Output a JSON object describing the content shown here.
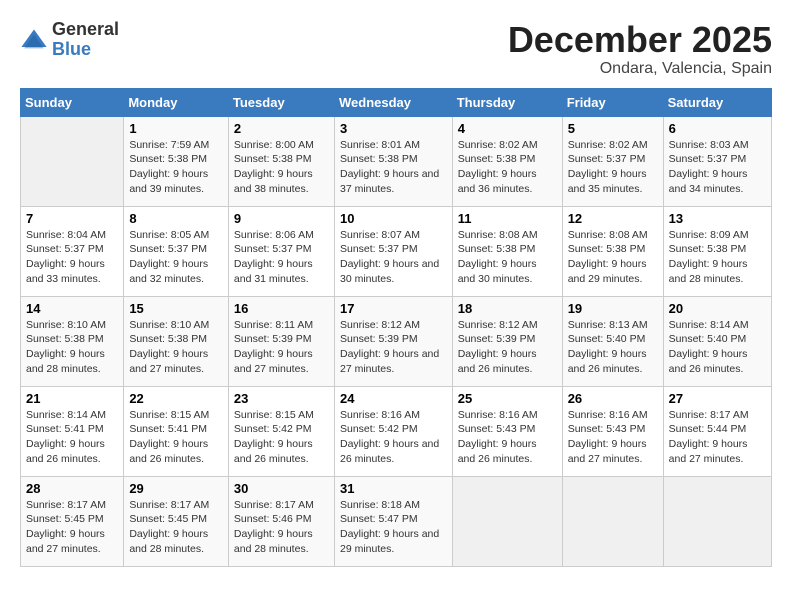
{
  "logo": {
    "general": "General",
    "blue": "Blue"
  },
  "title": "December 2025",
  "subtitle": "Ondara, Valencia, Spain",
  "days_header": [
    "Sunday",
    "Monday",
    "Tuesday",
    "Wednesday",
    "Thursday",
    "Friday",
    "Saturday"
  ],
  "weeks": [
    [
      {
        "num": "",
        "sunrise": "",
        "sunset": "",
        "daylight": ""
      },
      {
        "num": "1",
        "sunrise": "Sunrise: 7:59 AM",
        "sunset": "Sunset: 5:38 PM",
        "daylight": "Daylight: 9 hours and 39 minutes."
      },
      {
        "num": "2",
        "sunrise": "Sunrise: 8:00 AM",
        "sunset": "Sunset: 5:38 PM",
        "daylight": "Daylight: 9 hours and 38 minutes."
      },
      {
        "num": "3",
        "sunrise": "Sunrise: 8:01 AM",
        "sunset": "Sunset: 5:38 PM",
        "daylight": "Daylight: 9 hours and 37 minutes."
      },
      {
        "num": "4",
        "sunrise": "Sunrise: 8:02 AM",
        "sunset": "Sunset: 5:38 PM",
        "daylight": "Daylight: 9 hours and 36 minutes."
      },
      {
        "num": "5",
        "sunrise": "Sunrise: 8:02 AM",
        "sunset": "Sunset: 5:37 PM",
        "daylight": "Daylight: 9 hours and 35 minutes."
      },
      {
        "num": "6",
        "sunrise": "Sunrise: 8:03 AM",
        "sunset": "Sunset: 5:37 PM",
        "daylight": "Daylight: 9 hours and 34 minutes."
      }
    ],
    [
      {
        "num": "7",
        "sunrise": "Sunrise: 8:04 AM",
        "sunset": "Sunset: 5:37 PM",
        "daylight": "Daylight: 9 hours and 33 minutes."
      },
      {
        "num": "8",
        "sunrise": "Sunrise: 8:05 AM",
        "sunset": "Sunset: 5:37 PM",
        "daylight": "Daylight: 9 hours and 32 minutes."
      },
      {
        "num": "9",
        "sunrise": "Sunrise: 8:06 AM",
        "sunset": "Sunset: 5:37 PM",
        "daylight": "Daylight: 9 hours and 31 minutes."
      },
      {
        "num": "10",
        "sunrise": "Sunrise: 8:07 AM",
        "sunset": "Sunset: 5:37 PM",
        "daylight": "Daylight: 9 hours and 30 minutes."
      },
      {
        "num": "11",
        "sunrise": "Sunrise: 8:08 AM",
        "sunset": "Sunset: 5:38 PM",
        "daylight": "Daylight: 9 hours and 30 minutes."
      },
      {
        "num": "12",
        "sunrise": "Sunrise: 8:08 AM",
        "sunset": "Sunset: 5:38 PM",
        "daylight": "Daylight: 9 hours and 29 minutes."
      },
      {
        "num": "13",
        "sunrise": "Sunrise: 8:09 AM",
        "sunset": "Sunset: 5:38 PM",
        "daylight": "Daylight: 9 hours and 28 minutes."
      }
    ],
    [
      {
        "num": "14",
        "sunrise": "Sunrise: 8:10 AM",
        "sunset": "Sunset: 5:38 PM",
        "daylight": "Daylight: 9 hours and 28 minutes."
      },
      {
        "num": "15",
        "sunrise": "Sunrise: 8:10 AM",
        "sunset": "Sunset: 5:38 PM",
        "daylight": "Daylight: 9 hours and 27 minutes."
      },
      {
        "num": "16",
        "sunrise": "Sunrise: 8:11 AM",
        "sunset": "Sunset: 5:39 PM",
        "daylight": "Daylight: 9 hours and 27 minutes."
      },
      {
        "num": "17",
        "sunrise": "Sunrise: 8:12 AM",
        "sunset": "Sunset: 5:39 PM",
        "daylight": "Daylight: 9 hours and 27 minutes."
      },
      {
        "num": "18",
        "sunrise": "Sunrise: 8:12 AM",
        "sunset": "Sunset: 5:39 PM",
        "daylight": "Daylight: 9 hours and 26 minutes."
      },
      {
        "num": "19",
        "sunrise": "Sunrise: 8:13 AM",
        "sunset": "Sunset: 5:40 PM",
        "daylight": "Daylight: 9 hours and 26 minutes."
      },
      {
        "num": "20",
        "sunrise": "Sunrise: 8:14 AM",
        "sunset": "Sunset: 5:40 PM",
        "daylight": "Daylight: 9 hours and 26 minutes."
      }
    ],
    [
      {
        "num": "21",
        "sunrise": "Sunrise: 8:14 AM",
        "sunset": "Sunset: 5:41 PM",
        "daylight": "Daylight: 9 hours and 26 minutes."
      },
      {
        "num": "22",
        "sunrise": "Sunrise: 8:15 AM",
        "sunset": "Sunset: 5:41 PM",
        "daylight": "Daylight: 9 hours and 26 minutes."
      },
      {
        "num": "23",
        "sunrise": "Sunrise: 8:15 AM",
        "sunset": "Sunset: 5:42 PM",
        "daylight": "Daylight: 9 hours and 26 minutes."
      },
      {
        "num": "24",
        "sunrise": "Sunrise: 8:16 AM",
        "sunset": "Sunset: 5:42 PM",
        "daylight": "Daylight: 9 hours and 26 minutes."
      },
      {
        "num": "25",
        "sunrise": "Sunrise: 8:16 AM",
        "sunset": "Sunset: 5:43 PM",
        "daylight": "Daylight: 9 hours and 26 minutes."
      },
      {
        "num": "26",
        "sunrise": "Sunrise: 8:16 AM",
        "sunset": "Sunset: 5:43 PM",
        "daylight": "Daylight: 9 hours and 27 minutes."
      },
      {
        "num": "27",
        "sunrise": "Sunrise: 8:17 AM",
        "sunset": "Sunset: 5:44 PM",
        "daylight": "Daylight: 9 hours and 27 minutes."
      }
    ],
    [
      {
        "num": "28",
        "sunrise": "Sunrise: 8:17 AM",
        "sunset": "Sunset: 5:45 PM",
        "daylight": "Daylight: 9 hours and 27 minutes."
      },
      {
        "num": "29",
        "sunrise": "Sunrise: 8:17 AM",
        "sunset": "Sunset: 5:45 PM",
        "daylight": "Daylight: 9 hours and 28 minutes."
      },
      {
        "num": "30",
        "sunrise": "Sunrise: 8:17 AM",
        "sunset": "Sunset: 5:46 PM",
        "daylight": "Daylight: 9 hours and 28 minutes."
      },
      {
        "num": "31",
        "sunrise": "Sunrise: 8:18 AM",
        "sunset": "Sunset: 5:47 PM",
        "daylight": "Daylight: 9 hours and 29 minutes."
      },
      {
        "num": "",
        "sunrise": "",
        "sunset": "",
        "daylight": ""
      },
      {
        "num": "",
        "sunrise": "",
        "sunset": "",
        "daylight": ""
      },
      {
        "num": "",
        "sunrise": "",
        "sunset": "",
        "daylight": ""
      }
    ]
  ]
}
